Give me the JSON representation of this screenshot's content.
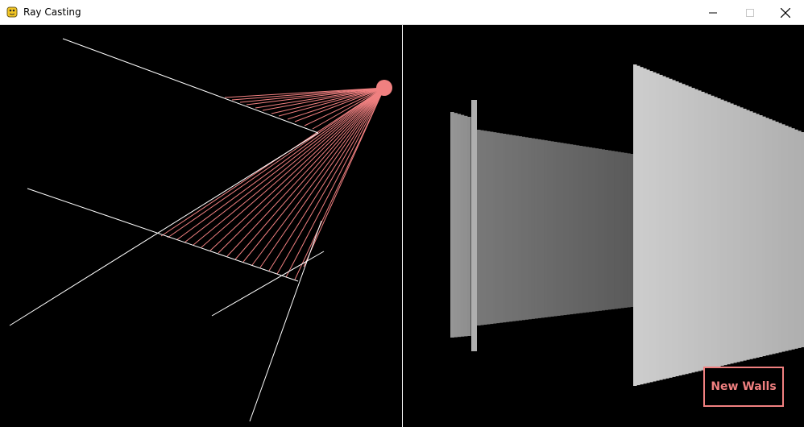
{
  "window": {
    "title": "Ray Casting",
    "icons": {
      "app": "pygame-snake-icon",
      "minimize": "minimize-icon",
      "maximize": "maximize-icon",
      "close": "close-icon"
    }
  },
  "scene": {
    "colors": {
      "background": "#000000",
      "wall": "#ffffff",
      "ray": "#f08080",
      "source": "#f08080",
      "divider": "#ffffff"
    }
  },
  "ui": {
    "new_walls_label": "New Walls",
    "accent": "#f08080"
  }
}
